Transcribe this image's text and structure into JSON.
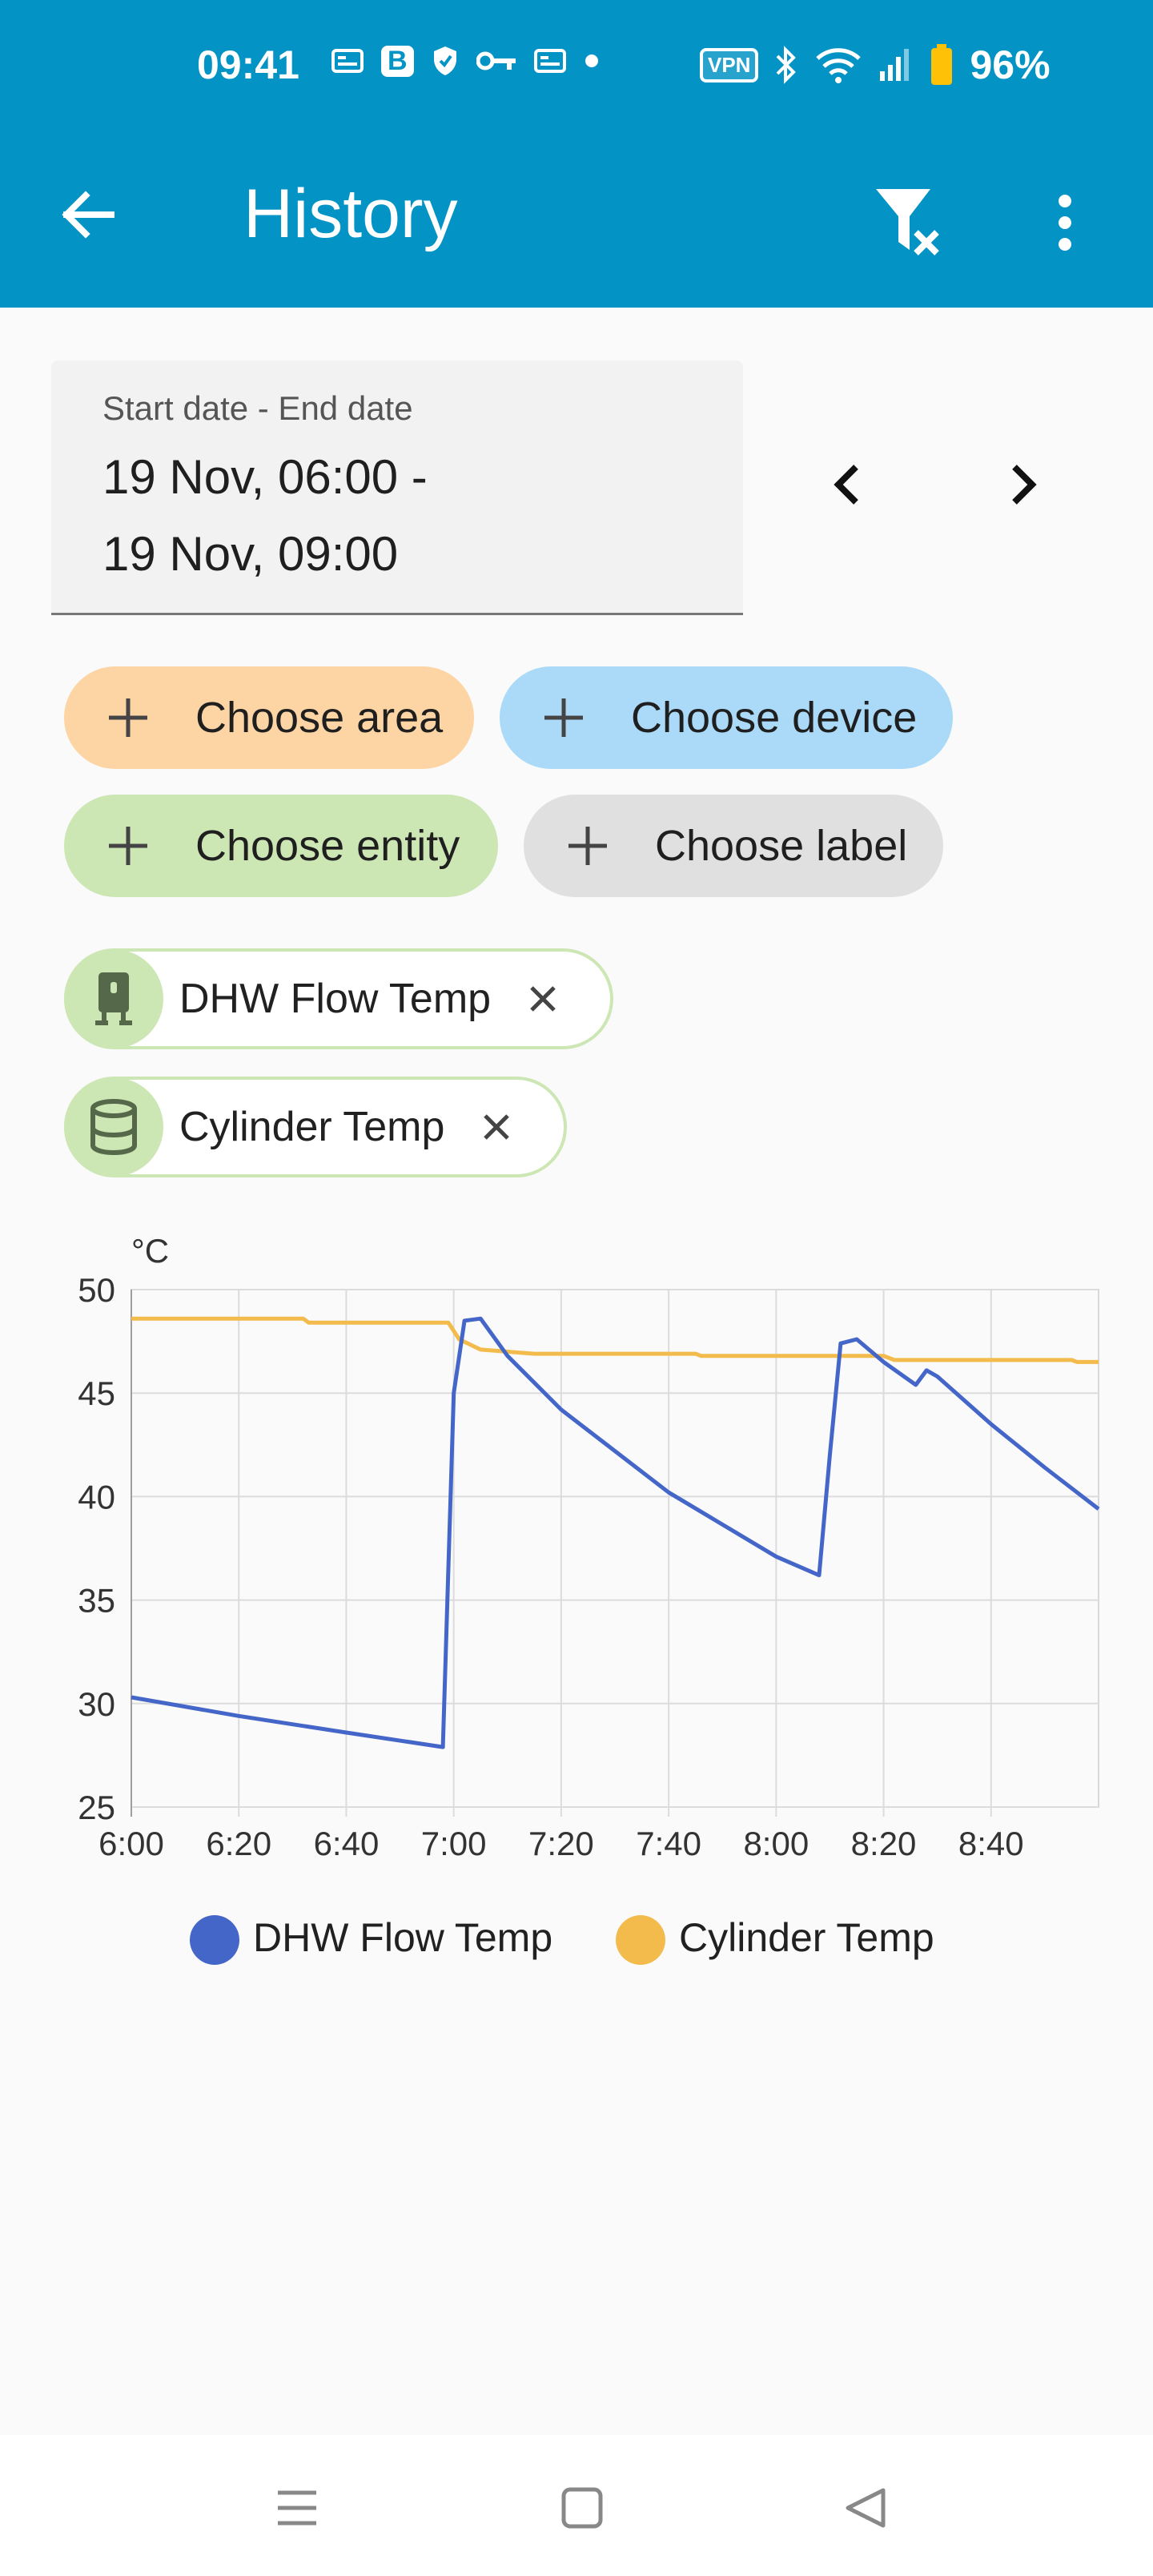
{
  "status_bar": {
    "time": "09:41",
    "left_icons": [
      "notification-icon",
      "b-app-icon",
      "shield-icon",
      "key-icon",
      "notification-icon",
      "dot-icon"
    ],
    "vpn": "VPN",
    "battery": "96%"
  },
  "toolbar": {
    "title": "History",
    "back_icon": "arrow-left-icon",
    "filter_icon": "filter-remove-icon",
    "more_icon": "more-vertical-icon"
  },
  "date_range": {
    "label": "Start date - End date",
    "value": "19 Nov, 06:00 -\n19 Nov, 09:00"
  },
  "targets": {
    "area": "Choose area",
    "device": "Choose device",
    "entity": "Choose entity",
    "label": "Choose label"
  },
  "entities": [
    {
      "name": "DHW Flow Temp",
      "icon": "water-heater-icon"
    },
    {
      "name": "Cylinder Temp",
      "icon": "cylinder-icon"
    }
  ],
  "colors": {
    "header": "#0393c5",
    "area": "#fdd4a3",
    "device": "#aadaf8",
    "entity": "#cce6b4",
    "label": "#e0e0e0",
    "dhw": "#4466c8",
    "cylinder": "#f2bb4c"
  },
  "chart_data": {
    "type": "line",
    "unit_label": "°C",
    "ylim": [
      25,
      50
    ],
    "yticks": [
      50,
      45,
      40,
      35,
      30,
      25
    ],
    "xlim_minutes": [
      0,
      180
    ],
    "xticks": [
      "6:00",
      "6:20",
      "6:40",
      "7:00",
      "7:20",
      "7:40",
      "8:00",
      "8:20",
      "8:40"
    ],
    "legend_position": "bottom",
    "grid": true,
    "series": [
      {
        "name": "DHW Flow Temp",
        "color": "#4466c8",
        "points": [
          [
            "6:00",
            30.3
          ],
          [
            "6:20",
            29.4
          ],
          [
            "6:40",
            28.6
          ],
          [
            "6:58",
            27.9
          ],
          [
            "6:58",
            28.0
          ],
          [
            "7:00",
            45.0
          ],
          [
            "7:02",
            48.5
          ],
          [
            "7:05",
            48.6
          ],
          [
            "7:10",
            46.8
          ],
          [
            "7:20",
            44.2
          ],
          [
            "7:40",
            40.2
          ],
          [
            "8:00",
            37.1
          ],
          [
            "8:08",
            36.2
          ],
          [
            "8:10",
            42.0
          ],
          [
            "8:12",
            47.4
          ],
          [
            "8:15",
            47.6
          ],
          [
            "8:20",
            46.5
          ],
          [
            "8:26",
            45.4
          ],
          [
            "8:28",
            46.1
          ],
          [
            "8:30",
            45.8
          ],
          [
            "8:40",
            43.5
          ],
          [
            "8:50",
            41.4
          ],
          [
            "9:00",
            39.4
          ]
        ]
      },
      {
        "name": "Cylinder Temp",
        "color": "#f2bb4c",
        "points": [
          [
            "6:00",
            48.6
          ],
          [
            "6:32",
            48.6
          ],
          [
            "6:33",
            48.4
          ],
          [
            "6:59",
            48.4
          ],
          [
            "7:01",
            47.6
          ],
          [
            "7:05",
            47.1
          ],
          [
            "7:15",
            46.9
          ],
          [
            "7:45",
            46.9
          ],
          [
            "7:46",
            46.8
          ],
          [
            "8:20",
            46.8
          ],
          [
            "8:22",
            46.6
          ],
          [
            "8:55",
            46.6
          ],
          [
            "8:56",
            46.5
          ],
          [
            "9:00",
            46.5
          ]
        ]
      }
    ]
  }
}
